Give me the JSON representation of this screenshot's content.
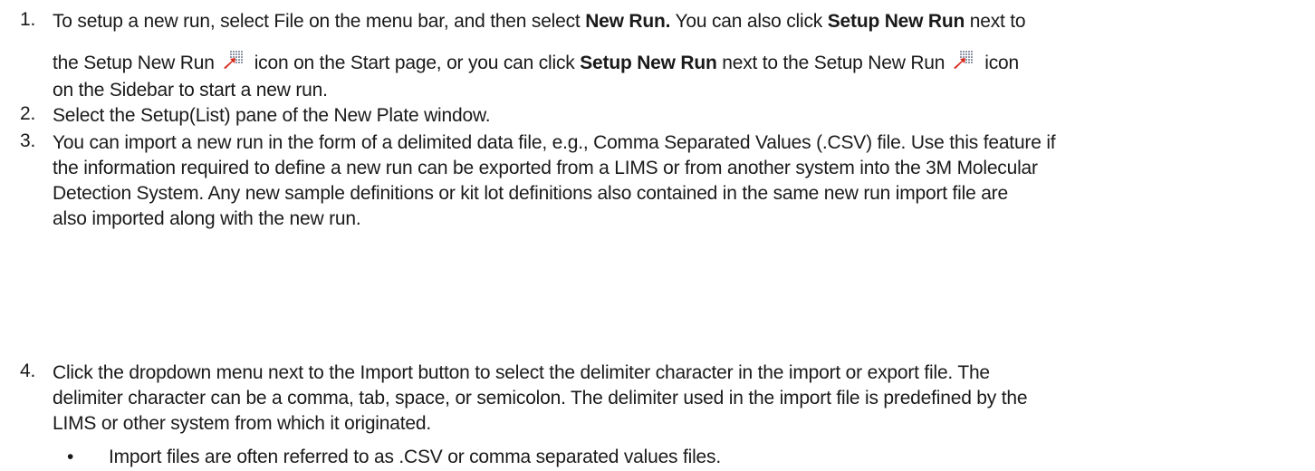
{
  "steps": [
    {
      "number": "1.",
      "lines": [
        {
          "t1": "To setup a new run, select File on the menu bar, and then select ",
          "b1": "New Run.",
          "t2": " You can also click ",
          "b2": "Setup New Run",
          "t3": " next to"
        },
        {
          "t1": "the Setup New Run",
          "icon1": "setup-new-run-icon",
          "t2": "icon on the Start page, or you can click ",
          "b1": "Setup New Run",
          "t3": " next to the Setup New Run",
          "icon2": "setup-new-run-icon",
          "t4": "icon"
        },
        {
          "t1": "on the Sidebar to start a new run."
        }
      ]
    },
    {
      "number": "2.",
      "lines": [
        {
          "t1": "Select the Setup(List) pane of the New Plate window."
        }
      ]
    },
    {
      "number": "3.",
      "lines": [
        {
          "t1": "You can import a new run in the form of a delimited data file, e.g., Comma Separated Values (.CSV) file. Use this feature if"
        },
        {
          "t1": "the information required to define a new run can be exported from a LIMS or from another system into the 3M Molecular"
        },
        {
          "t1": "Detection System. Any new sample definitions or kit lot definitions also contained in the same new run import file are"
        },
        {
          "t1": "also imported along with the new run."
        }
      ]
    },
    {
      "number": "4.",
      "lines": [
        {
          "t1": "Click the dropdown menu next to the Import button to select the delimiter character in the import or export file. The"
        },
        {
          "t1": "delimiter character can be a comma, tab, space, or semicolon. The delimiter used in the import file is predefined by the"
        },
        {
          "t1": "LIMS or other system from which it originated."
        }
      ]
    }
  ],
  "bullet": {
    "symbol": "•",
    "text": "Import files are often referred to as .CSV or comma separated values files."
  },
  "colors": {
    "text": "#1a1a1a",
    "icon_grid": "#8f97a8",
    "icon_arrow": "#d8281c"
  }
}
